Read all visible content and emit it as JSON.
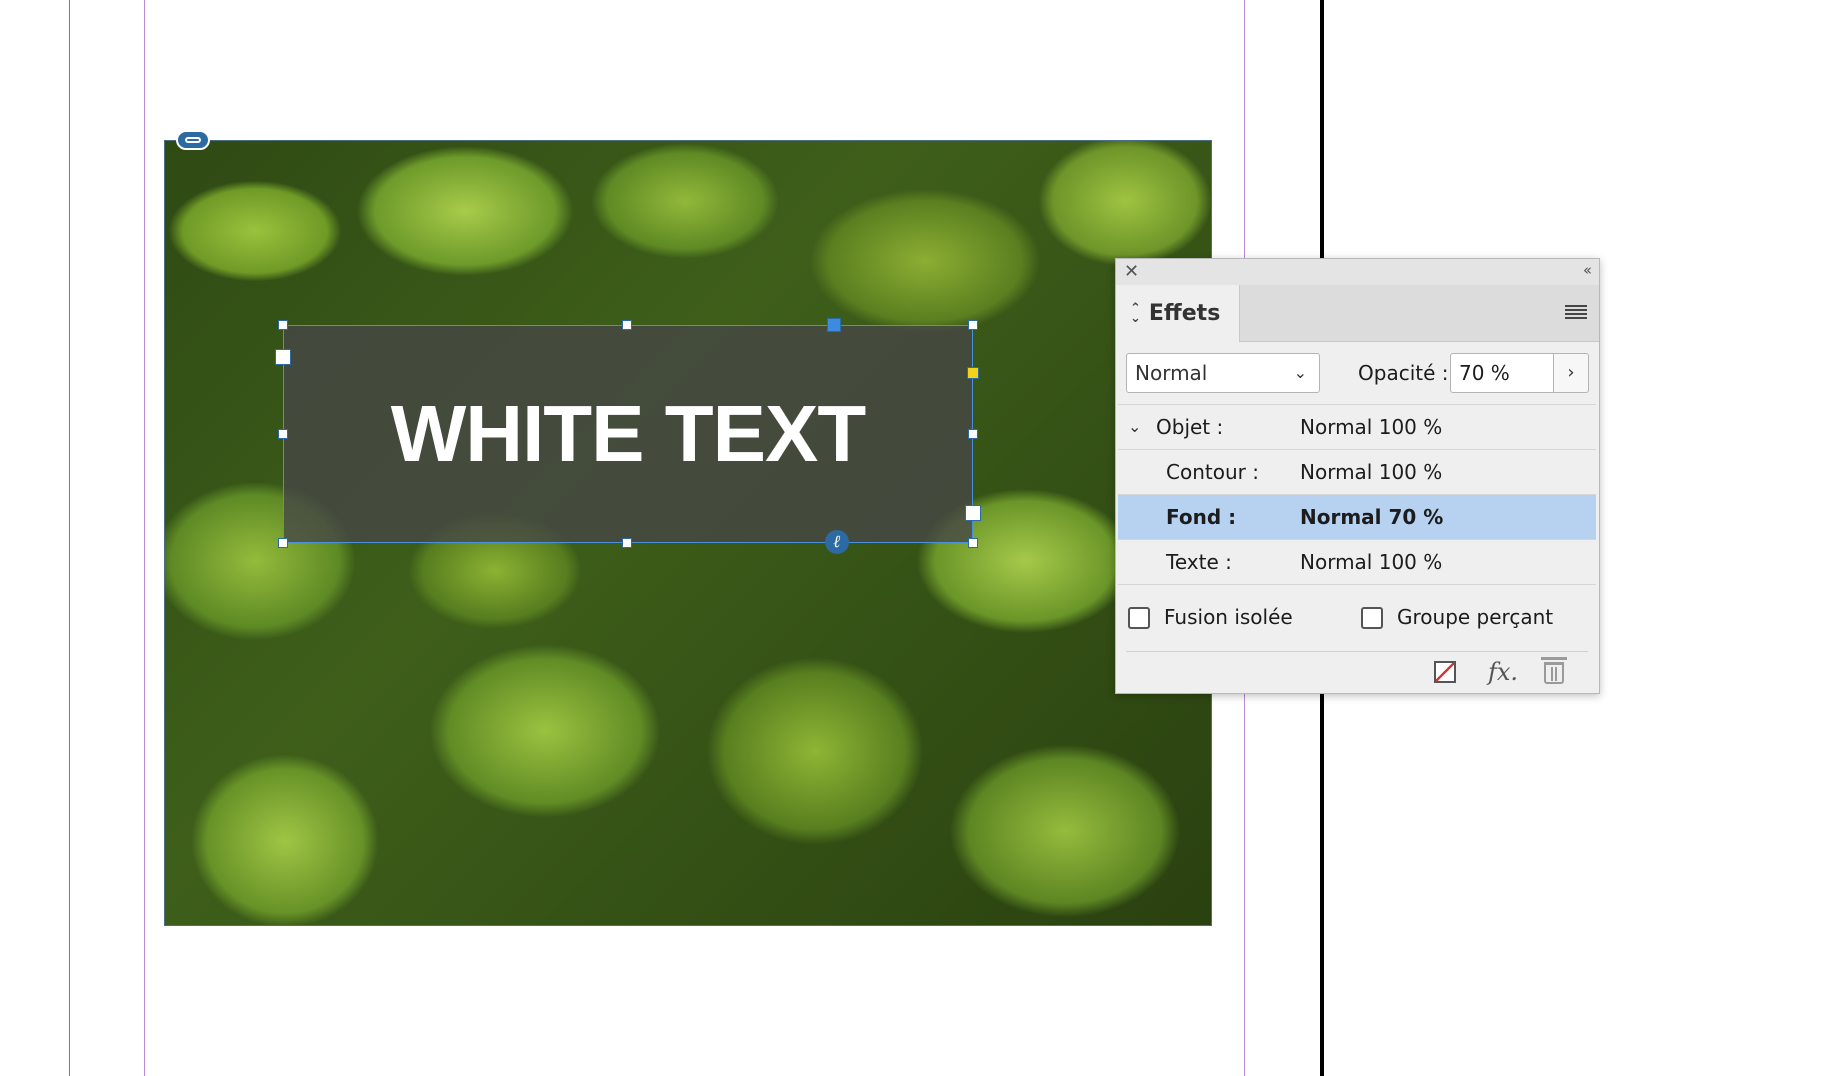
{
  "canvas": {
    "frame_text": "WHITE TEXT"
  },
  "effects_panel": {
    "tab_label": "Effets",
    "blend_mode": "Normal",
    "opacity_label": "Opacité :",
    "opacity_value": "70 %",
    "rows": [
      {
        "label": "Objet :",
        "value": "Normal 100 %"
      },
      {
        "label": "Contour :",
        "value": "Normal 100 %"
      },
      {
        "label": "Fond :",
        "value": "Normal 70 %"
      },
      {
        "label": "Texte :",
        "value": "Normal 100 %"
      }
    ],
    "checkbox_isolate": "Fusion isolée",
    "checkbox_knockout": "Groupe perçant",
    "icons": [
      "close-icon",
      "collapse-icon",
      "panel-menu-icon",
      "clear-effects-icon",
      "fx-icon",
      "trash-icon"
    ]
  }
}
